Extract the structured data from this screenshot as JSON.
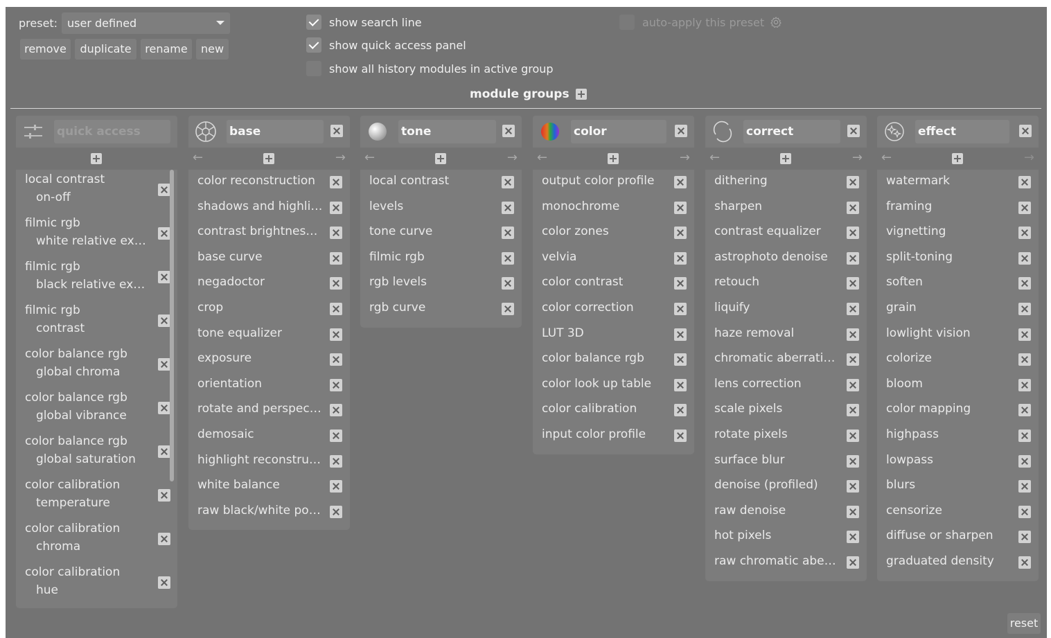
{
  "preset": {
    "label": "preset:",
    "value": "user defined",
    "buttons": {
      "remove": "remove",
      "duplicate": "duplicate",
      "rename": "rename",
      "new": "new"
    }
  },
  "options": {
    "show_search_line": {
      "label": "show search line",
      "checked": true
    },
    "show_quick_access": {
      "label": "show quick access panel",
      "checked": true
    },
    "show_all_history": {
      "label": "show all history modules in active group",
      "checked": false
    },
    "auto_apply": {
      "label": "auto-apply this preset",
      "checked": false
    }
  },
  "module_groups": {
    "title": "module groups",
    "quick_access": {
      "placeholder": "quick access",
      "icon": "sliders-icon",
      "items": [
        {
          "module": "local contrast",
          "param": "on-off"
        },
        {
          "module": "filmic rgb",
          "param": "white relative expo…"
        },
        {
          "module": "filmic rgb",
          "param": "black relative expo…"
        },
        {
          "module": "filmic rgb",
          "param": "contrast"
        },
        {
          "module": "color balance rgb",
          "param": "global chroma"
        },
        {
          "module": "color balance rgb",
          "param": "global vibrance"
        },
        {
          "module": "color balance rgb",
          "param": "global saturation"
        },
        {
          "module": "color calibration",
          "param": "temperature"
        },
        {
          "module": "color calibration",
          "param": "chroma"
        },
        {
          "module": "color calibration",
          "param": "hue"
        }
      ]
    },
    "groups": [
      {
        "name": "base",
        "icon": "aperture-icon",
        "items": [
          "color reconstruction",
          "shadows and highlights",
          "contrast brightness sa…",
          "base curve",
          "negadoctor",
          "crop",
          "tone equalizer",
          "exposure",
          "orientation",
          "rotate and perspective",
          "demosaic",
          "highlight reconstruction",
          "white balance",
          "raw black/white point"
        ]
      },
      {
        "name": "tone",
        "icon": "sphere-icon",
        "items": [
          "local contrast",
          "levels",
          "tone curve",
          "filmic rgb",
          "rgb levels",
          "rgb curve"
        ]
      },
      {
        "name": "color",
        "icon": "color-wheel-icon",
        "items": [
          "output color profile",
          "monochrome",
          "color zones",
          "velvia",
          "color contrast",
          "color correction",
          "LUT 3D",
          "color balance rgb",
          "color look up table",
          "color calibration",
          "input color profile"
        ]
      },
      {
        "name": "correct",
        "icon": "circle-arrow-icon",
        "items": [
          "dithering",
          "sharpen",
          "contrast equalizer",
          "astrophoto denoise",
          "retouch",
          "liquify",
          "haze removal",
          "chromatic aberrations",
          "lens correction",
          "scale pixels",
          "rotate pixels",
          "surface blur",
          "denoise (profiled)",
          "raw denoise",
          "hot pixels",
          "raw chromatic aberrati…"
        ]
      },
      {
        "name": "effect",
        "icon": "sparkle-ball-icon",
        "items": [
          "watermark",
          "framing",
          "vignetting",
          "split-toning",
          "soften",
          "grain",
          "lowlight vision",
          "colorize",
          "bloom",
          "color mapping",
          "highpass",
          "lowpass",
          "blurs",
          "censorize",
          "diffuse or sharpen",
          "graduated density"
        ]
      }
    ]
  },
  "footer": {
    "reset": "reset"
  },
  "colors": {
    "background": "#737373",
    "panel": "#7c7c7c",
    "field": "#858585",
    "text": "#e4e4e4",
    "divider": "#d8d8d8"
  }
}
